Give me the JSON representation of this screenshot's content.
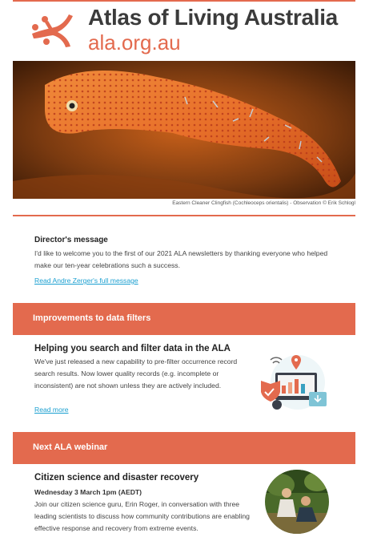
{
  "header": {
    "title": "Atlas of Living Australia",
    "url": "ala.org.au"
  },
  "hero": {
    "caption": "Eastern Cleaner Clingfish (Cochleoceps orientalis) - Observation © Erik Schlogl"
  },
  "director": {
    "heading": "Director's message",
    "body": "I'd like to welcome you to the first of our 2021 ALA newsletters by thanking everyone who helped make our ten-year celebrations such a success.",
    "link": "Read Andre Zerger's full message"
  },
  "filters_section": {
    "banner": "Improvements to data filters",
    "heading": "Helping you search and filter data in the ALA",
    "body": "We've just released a new capability to pre-filter occurrence record search results. Now lower quality records (e.g. incomplete or inconsistent) are not shown unless they are actively included.",
    "link": "Read more"
  },
  "webinar_section": {
    "banner": "Next ALA webinar",
    "heading": "Citizen science and disaster recovery",
    "date": "Wednesday 3 March 1pm (AEDT)",
    "body": "Join our citizen science guru, Erin Roger, in conversation with three leading scientists to discuss how community contributions are enabling effective response and recovery from extreme events."
  },
  "colors": {
    "brand": "#e36a4e",
    "link": "#1a9fd0"
  }
}
